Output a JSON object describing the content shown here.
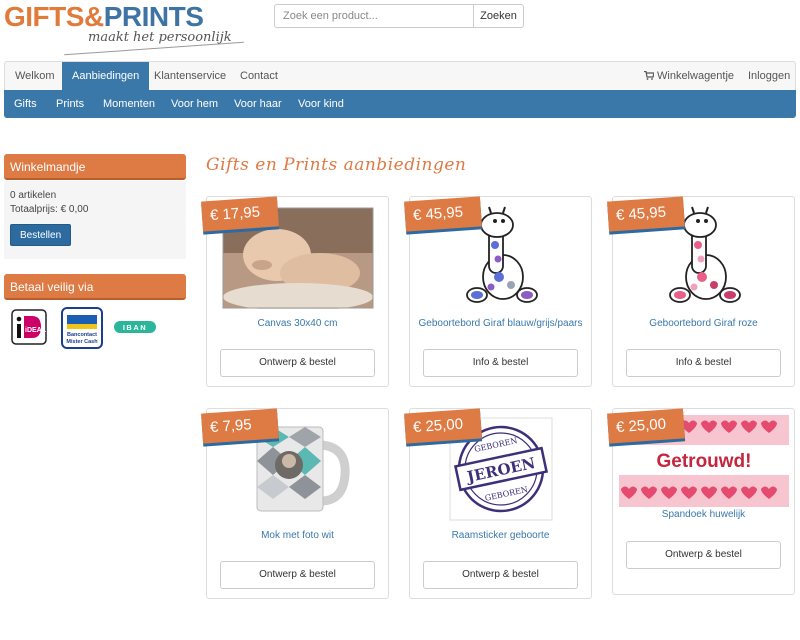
{
  "logo": {
    "part1": "GIFTS",
    "amp": "&",
    "part2": "PRINTS",
    "tagline": "maakt het persoonlijk"
  },
  "search": {
    "placeholder": "Zoek een product...",
    "button_label": "Zoeken"
  },
  "main_nav": {
    "items": [
      {
        "label": "Welkom"
      },
      {
        "label": "Aanbiedingen"
      },
      {
        "label": "Klantenservice"
      },
      {
        "label": "Contact"
      }
    ],
    "cart_label": "Winkelwagentje",
    "login_label": "Inloggen"
  },
  "category_nav": {
    "items": [
      {
        "label": "Gifts"
      },
      {
        "label": "Prints"
      },
      {
        "label": "Momenten"
      },
      {
        "label": "Voor hem"
      },
      {
        "label": "Voor haar"
      },
      {
        "label": "Voor kind"
      }
    ]
  },
  "sidebar": {
    "cart": {
      "title": "Winkelmandje",
      "items_text": "0 artikelen",
      "total_text": "Totaalprijs: € 0,00",
      "order_button": "Bestellen"
    },
    "payment": {
      "title": "Betaal veilig via",
      "icons": [
        "ideal-icon",
        "bancontact-icon",
        "iban-icon"
      ],
      "ideal_text": "iDEAL",
      "bancontact_line1": "Bancontact",
      "bancontact_line2": "Mister Cash",
      "iban_text": "IBAN"
    }
  },
  "page_title": "Gifts en Prints aanbiedingen",
  "products": [
    {
      "price": "€ 17,95",
      "name": "Canvas 30x40 cm",
      "button": "Ontwerp & bestel"
    },
    {
      "price": "€ 45,95",
      "name": "Geboortebord Giraf blauw/grijs/paars",
      "button": "Info & bestel"
    },
    {
      "price": "€ 45,95",
      "name": "Geboortebord Giraf roze",
      "button": "Info & bestel"
    },
    {
      "price": "€ 7,95",
      "name": "Mok met foto wit",
      "button": "Ontwerp & bestel"
    },
    {
      "price": "€ 25,00",
      "name": "Raamsticker geboorte",
      "button": "Ontwerp & bestel",
      "sticker_top": "GEBOREN",
      "sticker_name": "JEROEN",
      "sticker_bottom": "GEBOREN"
    },
    {
      "price": "€ 25,00",
      "name": "Spandoek huwelijk",
      "button": "Ontwerp & bestel",
      "banner_text": "Getrouwd!"
    }
  ],
  "colors": {
    "brand_orange": "#de7a44",
    "brand_blue": "#3a78aa"
  }
}
